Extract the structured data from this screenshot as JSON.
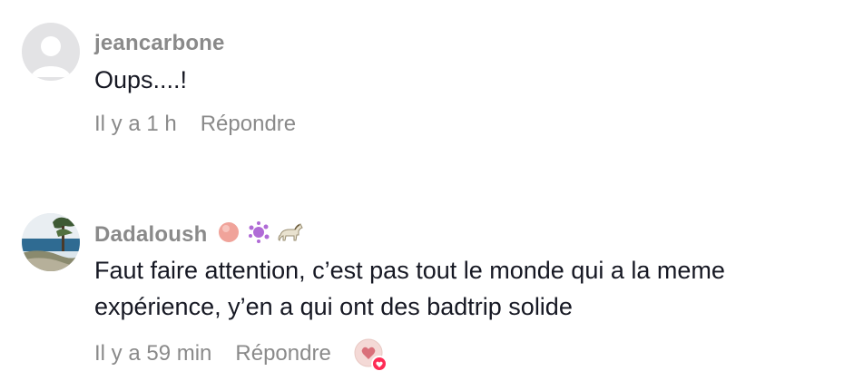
{
  "comments": [
    {
      "username": "jeancarbone",
      "text": "Oups....!",
      "time": "Il y a 1 h",
      "reply_label": "Répondre"
    },
    {
      "username": "Dadaloush",
      "username_emojis": [
        "peach-circle-emoji",
        "purple-splash-emoji",
        "horse-emoji"
      ],
      "text": "Faut faire attention, c’est pas tout le monde qui a la meme expérience, y’en a qui ont des badtrip solide",
      "time": "Il y a 59 min",
      "reply_label": "Répondre"
    }
  ],
  "colors": {
    "meta_gray": "#8a8a8a",
    "text_dark": "#161823",
    "heart_red": "#fe2c55"
  }
}
